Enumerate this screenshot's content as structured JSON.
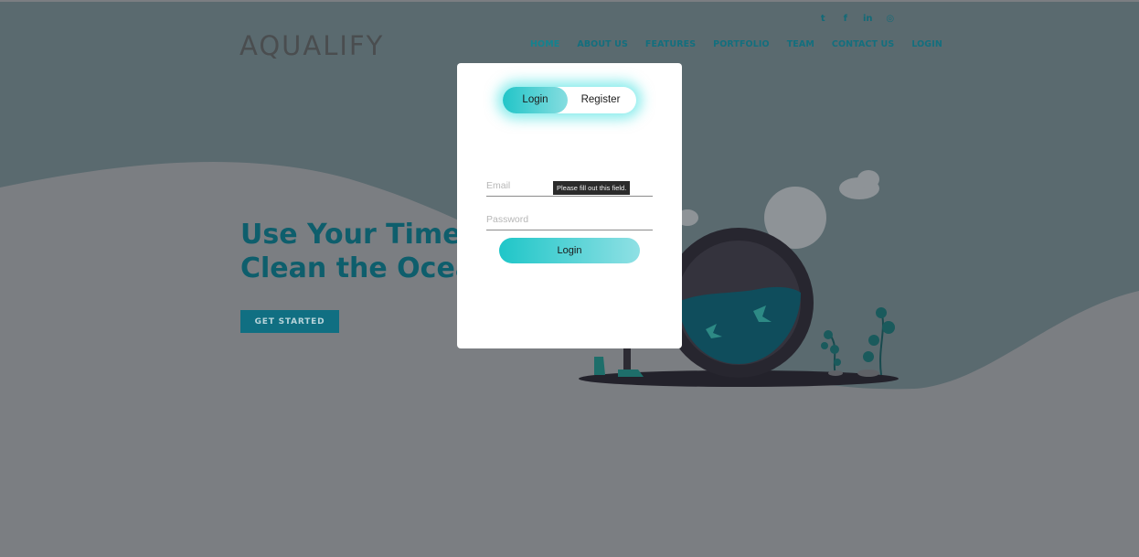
{
  "brand": {
    "name": "AQUALIFY"
  },
  "social": [
    {
      "icon": "twitter-icon",
      "glyph": "t"
    },
    {
      "icon": "facebook-icon",
      "glyph": "f"
    },
    {
      "icon": "linkedin-icon",
      "glyph": "in"
    },
    {
      "icon": "instagram-icon",
      "glyph": "◎"
    }
  ],
  "nav": [
    "HOME",
    "ABOUT US",
    "FEATURES",
    "PORTFOLIO",
    "TEAM",
    "CONTACT US",
    "LOGIN"
  ],
  "hero": {
    "line1": "Use Your Time",
    "line2": "Clean the Ocea",
    "cta": "GET STARTED"
  },
  "modal": {
    "tab_login": "Login",
    "tab_register": "Register",
    "email_placeholder": "Email",
    "password_placeholder": "Password",
    "tooltip": "Please fill out this field.",
    "submit": "Login"
  },
  "colors": {
    "accent": "#22c5c8",
    "nav_text": "#136f7e",
    "cta_bg": "#106f82",
    "hero_text": "#0e5e6c"
  }
}
